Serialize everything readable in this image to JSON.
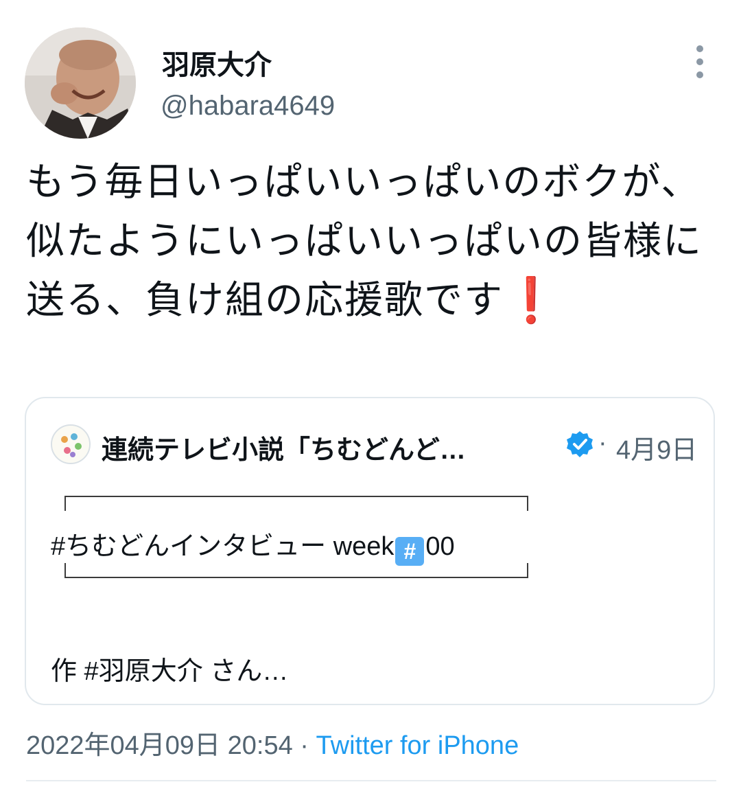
{
  "author": {
    "display_name": "羽原大介",
    "handle": "@habara4649",
    "avatar_icon": "user-avatar"
  },
  "tweet": {
    "text": "もう毎日いっぱいいっぱいのボクが、似たようにいっぱいいっぱいの皆様に送る、負け組の応援歌です",
    "emoji": "❗"
  },
  "quote": {
    "account_name": "連続テレビ小説「ちむどんど…",
    "verified_icon": "verified-badge-icon",
    "separator": "·",
    "date": "4月9日",
    "line1_prefix": "#ちむどんインタビュー week",
    "line1_emoji": "#",
    "line1_suffix": "00",
    "line2": "作 #羽原大介 さん…"
  },
  "meta": {
    "timestamp": "2022年04月09日 20:54",
    "separator": " · ",
    "source": "Twitter for iPhone"
  },
  "colors": {
    "text": "#0f1419",
    "secondary": "#536471",
    "link": "#1d9bf0",
    "verified": "#1d9bf0",
    "exclamation": "#e0202e"
  }
}
